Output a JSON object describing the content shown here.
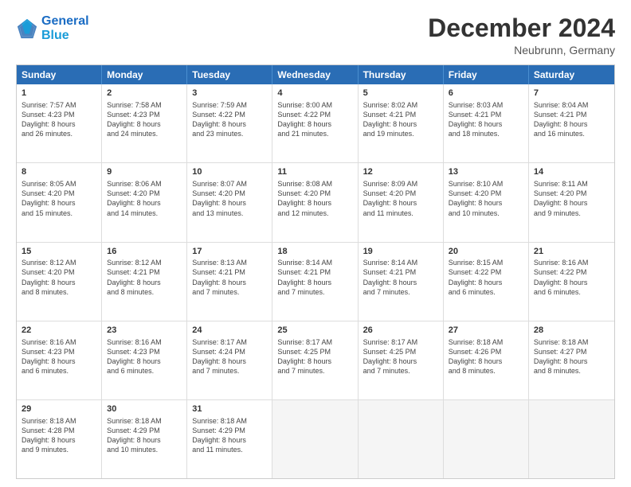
{
  "logo": {
    "line1": "General",
    "line2": "Blue"
  },
  "title": "December 2024",
  "subtitle": "Neubrunn, Germany",
  "days": [
    "Sunday",
    "Monday",
    "Tuesday",
    "Wednesday",
    "Thursday",
    "Friday",
    "Saturday"
  ],
  "weeks": [
    [
      {
        "day": "1",
        "text": "Sunrise: 7:57 AM\nSunset: 4:23 PM\nDaylight: 8 hours\nand 26 minutes."
      },
      {
        "day": "2",
        "text": "Sunrise: 7:58 AM\nSunset: 4:23 PM\nDaylight: 8 hours\nand 24 minutes."
      },
      {
        "day": "3",
        "text": "Sunrise: 7:59 AM\nSunset: 4:22 PM\nDaylight: 8 hours\nand 23 minutes."
      },
      {
        "day": "4",
        "text": "Sunrise: 8:00 AM\nSunset: 4:22 PM\nDaylight: 8 hours\nand 21 minutes."
      },
      {
        "day": "5",
        "text": "Sunrise: 8:02 AM\nSunset: 4:21 PM\nDaylight: 8 hours\nand 19 minutes."
      },
      {
        "day": "6",
        "text": "Sunrise: 8:03 AM\nSunset: 4:21 PM\nDaylight: 8 hours\nand 18 minutes."
      },
      {
        "day": "7",
        "text": "Sunrise: 8:04 AM\nSunset: 4:21 PM\nDaylight: 8 hours\nand 16 minutes."
      }
    ],
    [
      {
        "day": "8",
        "text": "Sunrise: 8:05 AM\nSunset: 4:20 PM\nDaylight: 8 hours\nand 15 minutes."
      },
      {
        "day": "9",
        "text": "Sunrise: 8:06 AM\nSunset: 4:20 PM\nDaylight: 8 hours\nand 14 minutes."
      },
      {
        "day": "10",
        "text": "Sunrise: 8:07 AM\nSunset: 4:20 PM\nDaylight: 8 hours\nand 13 minutes."
      },
      {
        "day": "11",
        "text": "Sunrise: 8:08 AM\nSunset: 4:20 PM\nDaylight: 8 hours\nand 12 minutes."
      },
      {
        "day": "12",
        "text": "Sunrise: 8:09 AM\nSunset: 4:20 PM\nDaylight: 8 hours\nand 11 minutes."
      },
      {
        "day": "13",
        "text": "Sunrise: 8:10 AM\nSunset: 4:20 PM\nDaylight: 8 hours\nand 10 minutes."
      },
      {
        "day": "14",
        "text": "Sunrise: 8:11 AM\nSunset: 4:20 PM\nDaylight: 8 hours\nand 9 minutes."
      }
    ],
    [
      {
        "day": "15",
        "text": "Sunrise: 8:12 AM\nSunset: 4:20 PM\nDaylight: 8 hours\nand 8 minutes."
      },
      {
        "day": "16",
        "text": "Sunrise: 8:12 AM\nSunset: 4:21 PM\nDaylight: 8 hours\nand 8 minutes."
      },
      {
        "day": "17",
        "text": "Sunrise: 8:13 AM\nSunset: 4:21 PM\nDaylight: 8 hours\nand 7 minutes."
      },
      {
        "day": "18",
        "text": "Sunrise: 8:14 AM\nSunset: 4:21 PM\nDaylight: 8 hours\nand 7 minutes."
      },
      {
        "day": "19",
        "text": "Sunrise: 8:14 AM\nSunset: 4:21 PM\nDaylight: 8 hours\nand 7 minutes."
      },
      {
        "day": "20",
        "text": "Sunrise: 8:15 AM\nSunset: 4:22 PM\nDaylight: 8 hours\nand 6 minutes."
      },
      {
        "day": "21",
        "text": "Sunrise: 8:16 AM\nSunset: 4:22 PM\nDaylight: 8 hours\nand 6 minutes."
      }
    ],
    [
      {
        "day": "22",
        "text": "Sunrise: 8:16 AM\nSunset: 4:23 PM\nDaylight: 8 hours\nand 6 minutes."
      },
      {
        "day": "23",
        "text": "Sunrise: 8:16 AM\nSunset: 4:23 PM\nDaylight: 8 hours\nand 6 minutes."
      },
      {
        "day": "24",
        "text": "Sunrise: 8:17 AM\nSunset: 4:24 PM\nDaylight: 8 hours\nand 7 minutes."
      },
      {
        "day": "25",
        "text": "Sunrise: 8:17 AM\nSunset: 4:25 PM\nDaylight: 8 hours\nand 7 minutes."
      },
      {
        "day": "26",
        "text": "Sunrise: 8:17 AM\nSunset: 4:25 PM\nDaylight: 8 hours\nand 7 minutes."
      },
      {
        "day": "27",
        "text": "Sunrise: 8:18 AM\nSunset: 4:26 PM\nDaylight: 8 hours\nand 8 minutes."
      },
      {
        "day": "28",
        "text": "Sunrise: 8:18 AM\nSunset: 4:27 PM\nDaylight: 8 hours\nand 8 minutes."
      }
    ],
    [
      {
        "day": "29",
        "text": "Sunrise: 8:18 AM\nSunset: 4:28 PM\nDaylight: 8 hours\nand 9 minutes."
      },
      {
        "day": "30",
        "text": "Sunrise: 8:18 AM\nSunset: 4:29 PM\nDaylight: 8 hours\nand 10 minutes."
      },
      {
        "day": "31",
        "text": "Sunrise: 8:18 AM\nSunset: 4:29 PM\nDaylight: 8 hours\nand 11 minutes."
      },
      {
        "day": "",
        "text": ""
      },
      {
        "day": "",
        "text": ""
      },
      {
        "day": "",
        "text": ""
      },
      {
        "day": "",
        "text": ""
      }
    ]
  ]
}
